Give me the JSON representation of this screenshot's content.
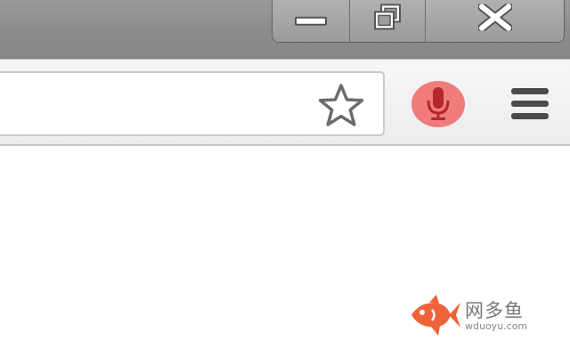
{
  "window_controls": {
    "minimize_icon": "minimize-icon",
    "restore_icon": "restore-icon",
    "close_icon": "close-icon"
  },
  "toolbar": {
    "address_value": "",
    "bookmark_icon": "star-outline-icon",
    "voice_icon": "microphone-icon",
    "menu_icon": "hamburger-menu-icon"
  },
  "colors": {
    "titlebar": "#8f8f8f",
    "mic_background": "#f07b7b",
    "mic_glyph": "#b2282c",
    "watermark_fish": "#f0623a"
  },
  "watermark": {
    "title": "网多鱼",
    "domain": "wduoyu.com"
  }
}
